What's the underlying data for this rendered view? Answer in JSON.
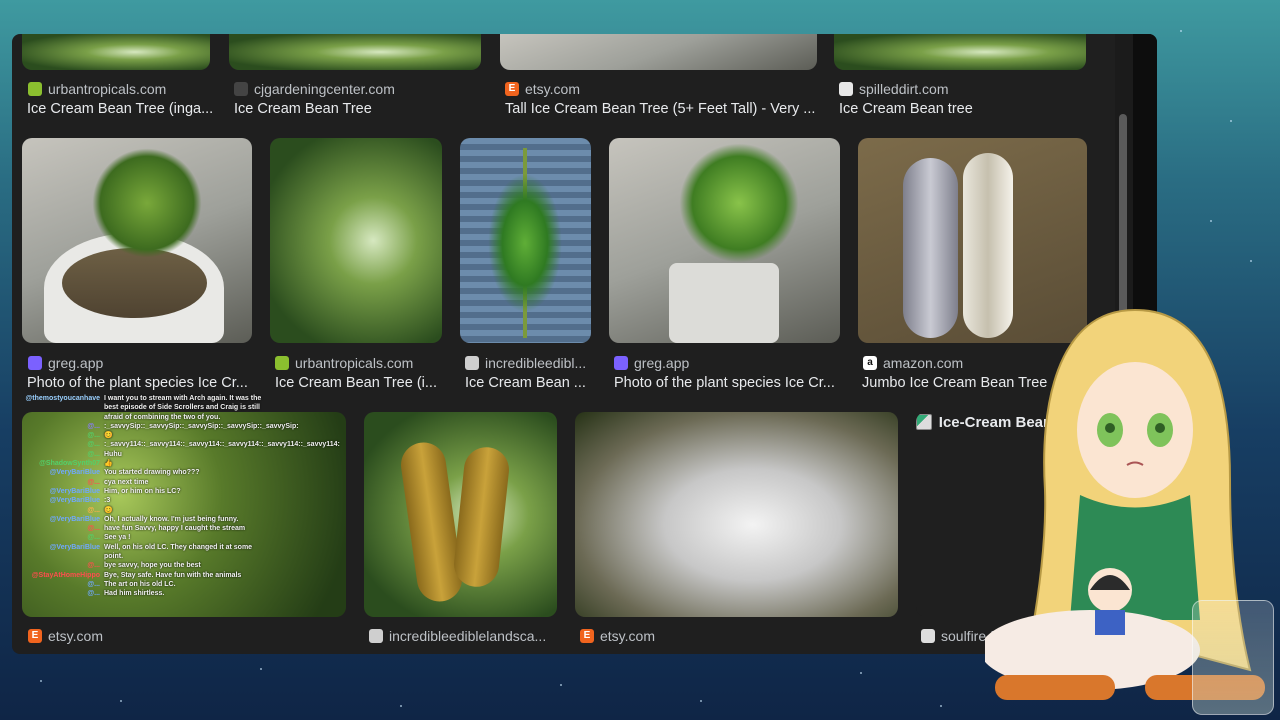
{
  "row1": [
    {
      "source": "urbantropicals.com",
      "title": "Ice Cream Bean Tree (inga...",
      "favicon": "urbantropicals-icon",
      "fav_color": "#8bbf2f"
    },
    {
      "source": "cjgardeningcenter.com",
      "title": "Ice Cream Bean Tree",
      "favicon": "leaf-icon",
      "fav_color": "#444444"
    },
    {
      "source": "etsy.com",
      "title": "Tall Ice Cream Bean Tree (5+ Feet Tall) - Very ...",
      "favicon": "etsy-icon",
      "fav_color": "#f1641e",
      "fav_glyph": "E"
    },
    {
      "source": "spilleddirt.com",
      "title": "Ice Cream Bean tree",
      "favicon": "spilleddirt-icon",
      "fav_color": "#e8e8e8"
    }
  ],
  "row2": [
    {
      "source": "greg.app",
      "title": "Photo of the plant species Ice Cr...",
      "favicon": "greg-icon",
      "fav_color": "#7b61ff"
    },
    {
      "source": "urbantropicals.com",
      "title": "Ice Cream Bean Tree (i...",
      "favicon": "urbantropicals-icon",
      "fav_color": "#8bbf2f"
    },
    {
      "source": "incredibleedibl...",
      "title": "Ice Cream Bean ...",
      "favicon": "incredibleedible-icon",
      "fav_color": "#cfcfcf"
    },
    {
      "source": "greg.app",
      "title": "Photo of the plant species Ice Cr...",
      "favicon": "greg-icon",
      "fav_color": "#7b61ff"
    },
    {
      "source": "amazon.com",
      "title": "Jumbo Ice Cream Bean Tree",
      "favicon": "amazon-icon",
      "fav_color": "#ffffff",
      "fav_glyph": "a"
    }
  ],
  "row3": [
    {
      "source": "etsy.com",
      "favicon": "etsy-icon",
      "fav_color": "#f1641e",
      "fav_glyph": "E"
    },
    {
      "source": "incredibleediblelandsca...",
      "favicon": "incredibleedible-icon",
      "fav_color": "#cfcfcf"
    },
    {
      "source": "etsy.com",
      "favicon": "etsy-icon",
      "fav_color": "#f1641e",
      "fav_glyph": "E"
    },
    {
      "source": "soulfire.f...",
      "favicon": "soulfire-icon",
      "fav_color": "#dddddd"
    }
  ],
  "broken_image_alt": "Ice-Cream Bean Tree",
  "chat": [
    {
      "user": "@themostyoucanhave",
      "color": "#9ad0ff",
      "text": "I want you to stream with Arch again. It was the best episode of Side Scrollers and Craig is still afraid of combining the two of you."
    },
    {
      "user": "@...",
      "color": "#8a7bff",
      "text": ":_savvySip::_savvySip::_savvySip::_savvySip::_savvySip:"
    },
    {
      "user": "@...",
      "color": "#53d16a",
      "text": "😊"
    },
    {
      "user": "@...",
      "color": "#53d16a",
      "text": ":_savvy114::_savvy114::_savvy114::_savvy114::_savvy114::_savvy114:"
    },
    {
      "user": "@...",
      "color": "#53d16a",
      "text": "Huhu"
    },
    {
      "user": "@ShadowSynth07",
      "color": "#53d16a",
      "text": "👍"
    },
    {
      "user": "@VeryBariBlue",
      "color": "#6fa8ff",
      "text": "You started drawing who???"
    },
    {
      "user": "@...",
      "color": "#ff4d4d",
      "text": "cya next time"
    },
    {
      "user": "@VeryBariBlue",
      "color": "#6fa8ff",
      "text": "Him, or him on his LC?"
    },
    {
      "user": "@VeryBariBlue",
      "color": "#6fa8ff",
      "text": ":3"
    },
    {
      "user": "@...",
      "color": "#ffb14d",
      "text": "😊"
    },
    {
      "user": "@VeryBariBlue",
      "color": "#6fa8ff",
      "text": "Oh, I actually know. I'm just being funny."
    },
    {
      "user": "@...",
      "color": "#ff4d4d",
      "text": "have fun Savvy, happy I caught the stream"
    },
    {
      "user": "@...",
      "color": "#53d16a",
      "text": "See ya !"
    },
    {
      "user": "@VeryBariBlue",
      "color": "#6fa8ff",
      "text": "Well, on his old LC. They changed it at some point."
    },
    {
      "user": "@...",
      "color": "#ff4d4d",
      "text": "bye savvy, hope you the best"
    },
    {
      "user": "@StayAtHomeHippo",
      "color": "#ff4d4d",
      "text": "Bye, Stay safe. Have fun with the animals"
    },
    {
      "user": "@...",
      "color": "#6fa8ff",
      "text": "The art on his old LC."
    },
    {
      "user": "@...",
      "color": "#6fa8ff",
      "text": "Had him shirtless."
    }
  ]
}
